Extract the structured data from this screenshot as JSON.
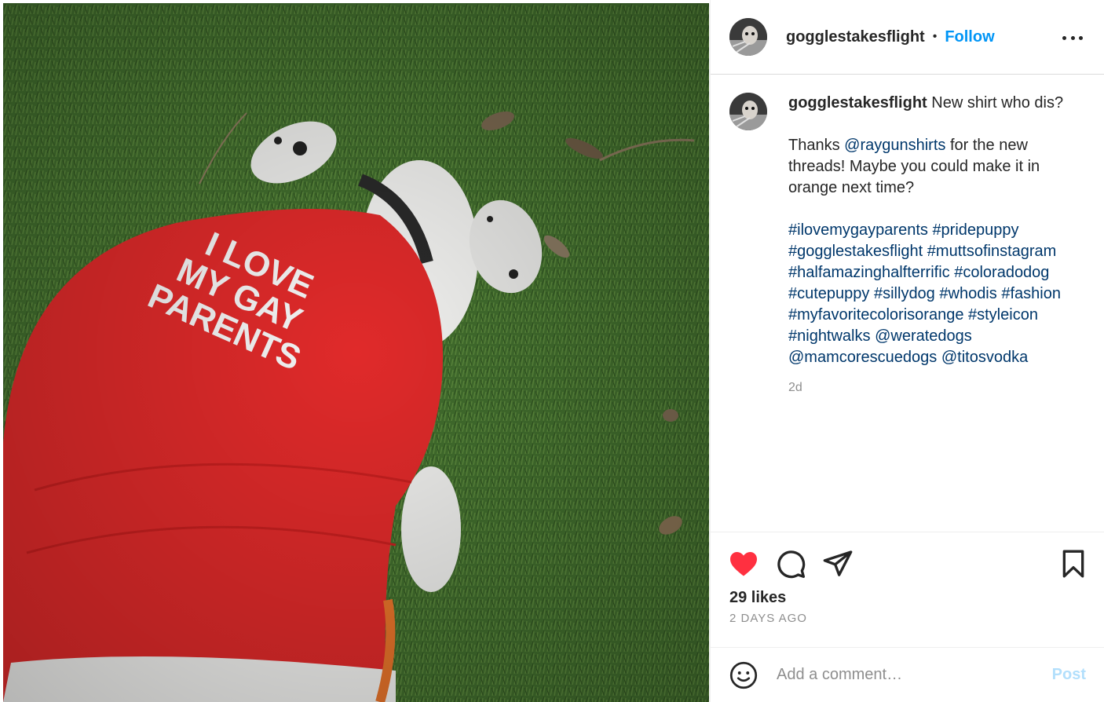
{
  "post": {
    "image_alt": "",
    "shirt_text": [
      "I LOVE",
      "MY GAY",
      "PARENTS"
    ]
  },
  "header": {
    "username": "gogglestakesflight",
    "separator": "•",
    "follow_label": "Follow",
    "more_icon": "more-horizontal-icon"
  },
  "caption": {
    "username": "gogglestakesflight",
    "line1": "New shirt who dis?",
    "thanks_prefix": "Thanks ",
    "mention1": "@raygunshirts",
    "thanks_suffix": " for the new threads! Maybe you could make it in orange next time?",
    "tags": [
      "#ilovemygayparents",
      "#pridepuppy",
      "#gogglestakesflight",
      "#muttsofinstagram",
      "#halfamazinghalfterrific",
      "#coloradodog",
      "#cutepuppy",
      "#sillydog",
      "#whodis",
      "#fashion",
      "#myfavoritecolorisorange",
      "#styleicon",
      "#nightwalks",
      "@weratedogs",
      "@mamcorescuedogs",
      "@titosvodka"
    ],
    "time": "2d"
  },
  "actions": {
    "like_icon": "heart-filled-icon",
    "comment_icon": "comment-icon",
    "share_icon": "share-icon",
    "save_icon": "bookmark-icon",
    "likes_text": "29 likes",
    "date_text": "2 DAYS AGO"
  },
  "comment": {
    "emoji_icon": "emoji-icon",
    "placeholder": "Add a comment…",
    "post_label": "Post"
  },
  "colors": {
    "accent": "#0095f6",
    "like_red": "#ff3040",
    "link": "#00376b",
    "post_disabled": "#b2dffc"
  }
}
